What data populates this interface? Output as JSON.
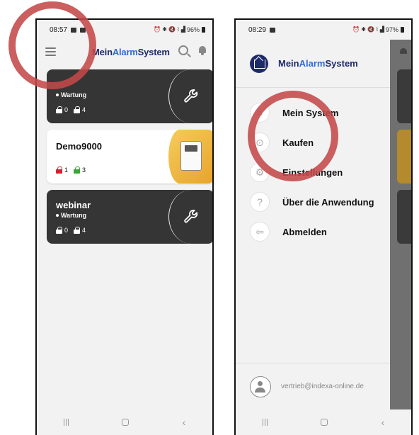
{
  "phone_a": {
    "status": {
      "time": "08:57",
      "battery": "96%"
    },
    "brand": {
      "part1": "Mein",
      "part2": "Alarm",
      "part3": "System"
    },
    "cards": [
      {
        "name": "",
        "status": "Wartung",
        "locked_red": "0",
        "locked_green": "4"
      },
      {
        "name": "Demo9000",
        "status": "",
        "locked_red": "1",
        "locked_green": "3"
      },
      {
        "name": "webinar",
        "status": "Wartung",
        "locked_red": "0",
        "locked_green": "4"
      }
    ]
  },
  "phone_b": {
    "status": {
      "time": "08:29",
      "battery": "97%"
    },
    "brand": {
      "part1": "Mein",
      "part2": "Alarm",
      "part3": "System"
    },
    "menu": [
      {
        "label": "Mein System",
        "icon": "list-icon"
      },
      {
        "label": "Kaufen",
        "icon": "cart-icon"
      },
      {
        "label": "Einstellungen",
        "icon": "gear-icon"
      },
      {
        "label": "Über die Anwendung",
        "icon": "question-icon"
      },
      {
        "label": "Abmelden",
        "icon": "logout-icon"
      }
    ],
    "user_email": "vertrieb@indexa-online.de"
  },
  "colors": {
    "accent_dark_blue": "#1f2a6b",
    "accent_blue": "#2f6bd8",
    "card_dark": "#353535",
    "card_yellow": "#e8a42a",
    "lock_red": "#d6202f",
    "lock_green": "#3aa637",
    "annotation_circle": "#c44848"
  }
}
